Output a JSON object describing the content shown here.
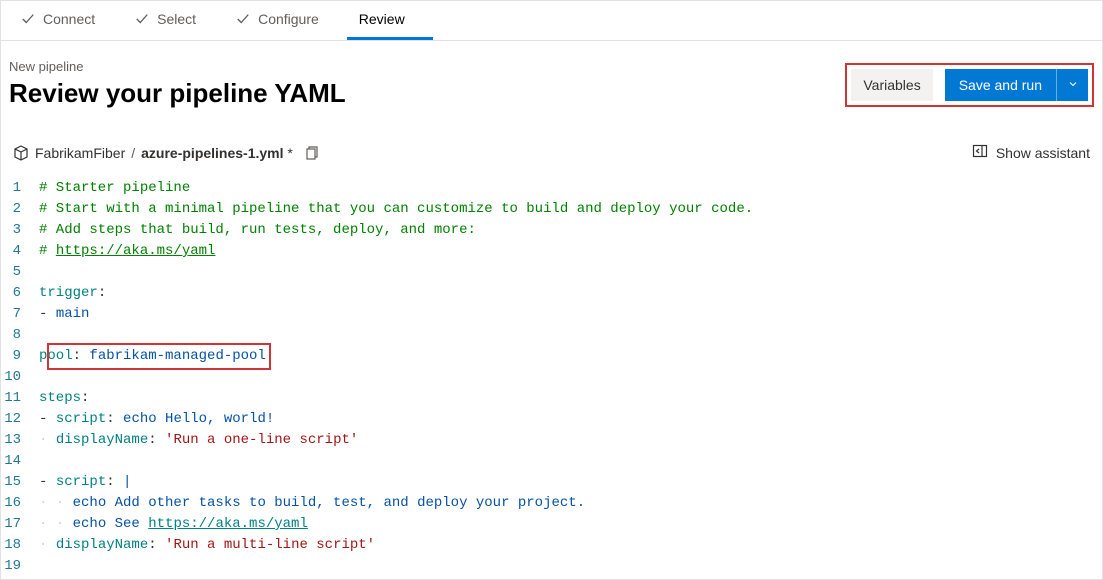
{
  "tabs": {
    "connect": "Connect",
    "select": "Select",
    "configure": "Configure",
    "review": "Review"
  },
  "header": {
    "subtitle": "New pipeline",
    "title": "Review your pipeline YAML",
    "variables_label": "Variables",
    "save_run_label": "Save and run"
  },
  "path": {
    "repo": "FabrikamFiber",
    "file": "azure-pipelines-1.yml",
    "modified_indicator": "*",
    "show_assistant": "Show assistant"
  },
  "code": {
    "l1": "# Starter pipeline",
    "l2": "# Start with a minimal pipeline that you can customize to build and deploy your code.",
    "l3": "# Add steps that build, run tests, deploy, and more:",
    "l4a": "# ",
    "l4b": "https://aka.ms/yaml",
    "l6_key": "trigger",
    "l7_value": "main",
    "l9_key": "pool",
    "l9_value": "fabrikam-managed-pool",
    "l11_key": "steps",
    "l12_key": "script",
    "l12_value": "echo Hello, world!",
    "l13_key": "displayName",
    "l13_value": "'Run a one-line script'",
    "l15_key": "script",
    "l15_value": "|",
    "l16": "echo Add other tasks to build, test, and deploy your project.",
    "l17a": "echo See ",
    "l17b": "https://aka.ms/yaml",
    "l18_key": "displayName",
    "l18_value": "'Run a multi-line script'"
  }
}
